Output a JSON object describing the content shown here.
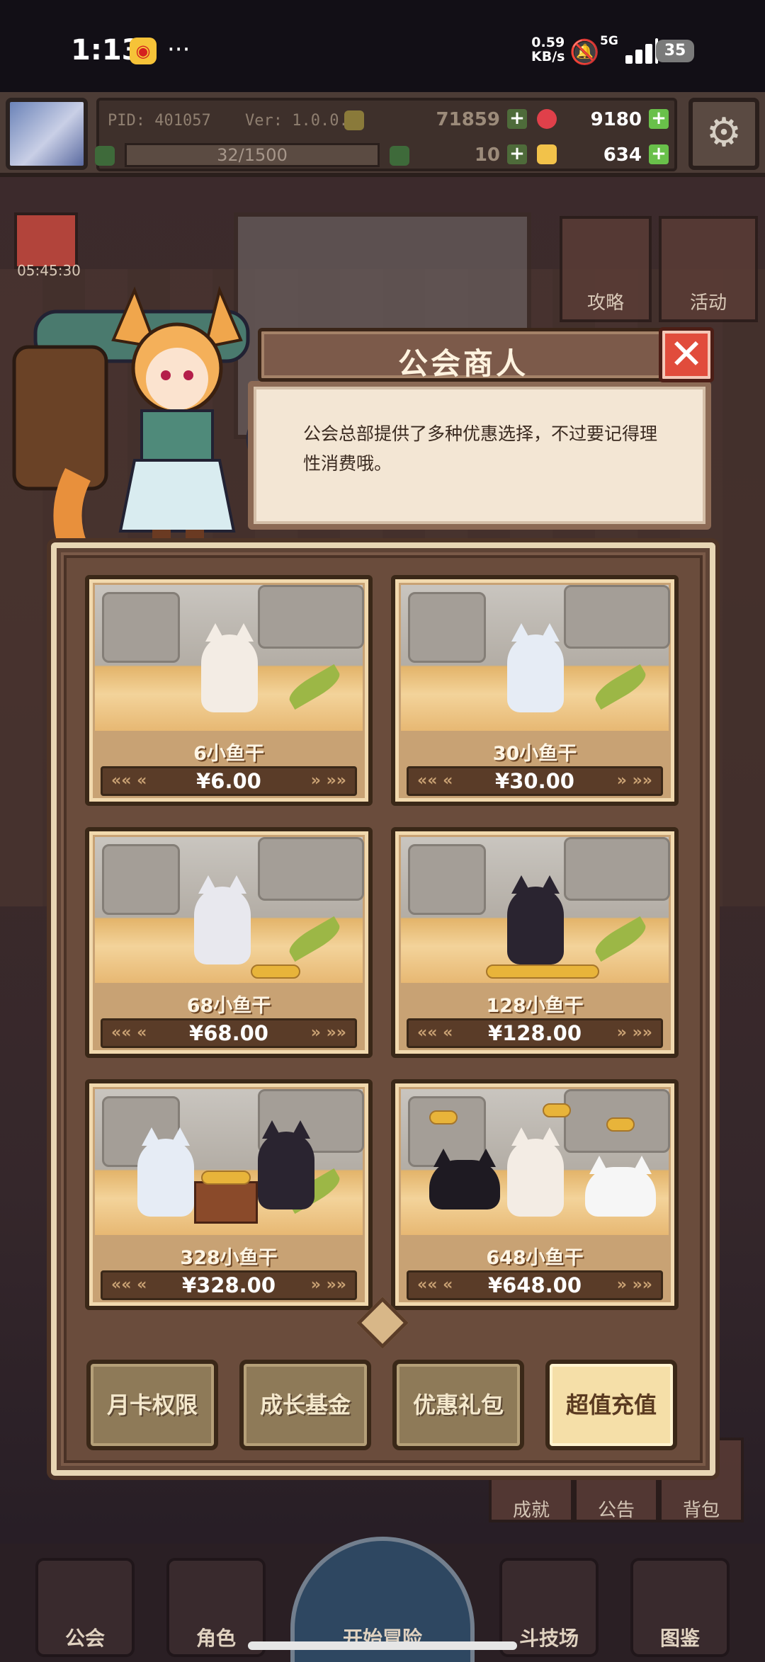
{
  "status_bar": {
    "time": "1:13",
    "app_icon": "weibo-icon",
    "more": "···",
    "net_speed_top": "0.59",
    "net_speed_unit": "KB/s",
    "signal_label": "5G",
    "battery": "35"
  },
  "hud": {
    "pid": "PID: 401057",
    "version": "Ver: 1.0.0.7",
    "stat_a": "71859",
    "gems": "9180",
    "xp": "32/1500",
    "clovers": "10",
    "gold": "634"
  },
  "background": {
    "timer": "05:45:30",
    "guide_label": "攻略",
    "event_label": "活动",
    "achievement_label": "成就",
    "notice_label": "公告",
    "bag_label": "背包"
  },
  "dialog": {
    "title": "公会商人",
    "close": "✕",
    "message": "公会总部提供了多种优惠选择，不过要记得理性消费哦。"
  },
  "shop": {
    "items": [
      {
        "name": "6小鱼干",
        "price": "¥6.00"
      },
      {
        "name": "30小鱼干",
        "price": "¥30.00"
      },
      {
        "name": "68小鱼干",
        "price": "¥68.00"
      },
      {
        "name": "128小鱼干",
        "price": "¥128.00"
      },
      {
        "name": "328小鱼干",
        "price": "¥328.00"
      },
      {
        "name": "648小鱼干",
        "price": "¥648.00"
      }
    ],
    "tabs": [
      {
        "label": "月卡权限",
        "active": false
      },
      {
        "label": "成长基金",
        "active": false
      },
      {
        "label": "优惠礼包",
        "active": false
      },
      {
        "label": "超值充值",
        "active": true
      }
    ]
  },
  "bottom_nav": {
    "items": [
      "公会",
      "角色",
      "开始冒险",
      "斗技场",
      "图鉴"
    ]
  },
  "colors": {
    "panel_border": "#e8d6b4",
    "close_red": "#e14c3c",
    "active_tab": "#f5dfa8",
    "plus_green": "#69c04a"
  }
}
